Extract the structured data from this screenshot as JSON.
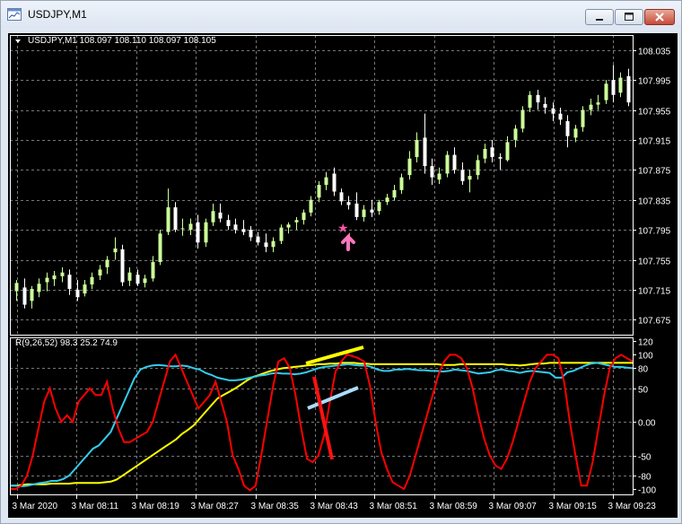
{
  "window": {
    "title": "USDJPY,M1"
  },
  "price_panel": {
    "info": "USDJPY,M1  108.097 108.110 108.097 108.105",
    "price_labels": [
      "108.035",
      "107.995",
      "107.955",
      "107.915",
      "107.875",
      "107.835",
      "107.795",
      "107.755",
      "107.715",
      "107.675"
    ]
  },
  "indicator_panel": {
    "info": "R(9,26,52) 98.3 25.2 74.9",
    "scale_labels": [
      "120",
      "100",
      "80",
      "50",
      "0.00",
      "-50",
      "-80",
      "-100"
    ]
  },
  "time_labels": [
    "3 Mar 2020",
    "3 Mar 08:11",
    "3 Mar 08:19",
    "3 Mar 08:27",
    "3 Mar 08:35",
    "3 Mar 08:43",
    "3 Mar 08:51",
    "3 Mar 08:59",
    "3 Mar 09:07",
    "3 Mar 09:15",
    "3 Mar 09:23"
  ],
  "colors": {
    "background": "#000000",
    "grid": "#777777",
    "bull_candle": "#ccff99",
    "bear_candle": "#ffffff",
    "fast_line": "#ff0000",
    "mid_line": "#33ccee",
    "slow_line": "#ffff00",
    "arrow": "#ff77bb"
  },
  "chart_data": {
    "type": "candlestick",
    "symbol": "USDJPY",
    "timeframe": "M1",
    "price_ylim": [
      107.655,
      108.055
    ],
    "candles": [
      [
        107.713,
        107.728,
        107.7,
        107.724
      ],
      [
        107.718,
        107.73,
        107.69,
        107.695
      ],
      [
        107.7,
        107.72,
        107.69,
        107.716
      ],
      [
        107.712,
        107.73,
        107.705,
        107.723
      ],
      [
        107.725,
        107.738,
        107.713,
        107.731
      ],
      [
        107.729,
        107.74,
        107.72,
        107.734
      ],
      [
        107.733,
        107.745,
        107.725,
        107.738
      ],
      [
        107.735,
        107.742,
        107.708,
        107.716
      ],
      [
        107.715,
        107.728,
        107.7,
        107.705
      ],
      [
        107.71,
        107.728,
        107.706,
        107.722
      ],
      [
        107.722,
        107.738,
        107.716,
        107.732
      ],
      [
        107.734,
        107.748,
        107.728,
        107.742
      ],
      [
        107.745,
        107.76,
        107.736,
        107.755
      ],
      [
        107.765,
        107.785,
        107.755,
        107.77
      ],
      [
        107.769,
        107.775,
        107.72,
        107.725
      ],
      [
        107.727,
        107.745,
        107.72,
        107.738
      ],
      [
        107.735,
        107.742,
        107.72,
        107.723
      ],
      [
        107.724,
        107.735,
        107.718,
        107.73
      ],
      [
        107.73,
        107.76,
        107.726,
        107.752
      ],
      [
        107.752,
        107.795,
        107.748,
        107.79
      ],
      [
        107.792,
        107.85,
        107.788,
        107.825
      ],
      [
        107.825,
        107.832,
        107.792,
        107.795
      ],
      [
        107.796,
        107.81,
        107.787,
        107.797
      ],
      [
        107.795,
        107.81,
        107.788,
        107.803
      ],
      [
        107.805,
        107.815,
        107.77,
        107.778
      ],
      [
        107.778,
        107.81,
        107.772,
        107.805
      ],
      [
        107.805,
        107.83,
        107.8,
        107.82
      ],
      [
        107.818,
        107.83,
        107.805,
        107.81
      ],
      [
        107.808,
        107.815,
        107.795,
        107.8
      ],
      [
        107.802,
        107.81,
        107.79,
        107.795
      ],
      [
        107.796,
        107.808,
        107.788,
        107.792
      ],
      [
        107.795,
        107.8,
        107.78,
        107.785
      ],
      [
        107.786,
        107.792,
        107.774,
        107.778
      ],
      [
        107.778,
        107.79,
        107.765,
        107.772
      ],
      [
        107.772,
        107.785,
        107.765,
        107.78
      ],
      [
        107.78,
        107.802,
        107.776,
        107.798
      ],
      [
        107.798,
        107.805,
        107.79,
        107.802
      ],
      [
        107.805,
        107.812,
        107.795,
        107.808
      ],
      [
        107.808,
        107.822,
        107.802,
        107.818
      ],
      [
        107.818,
        107.84,
        107.813,
        107.835
      ],
      [
        107.838,
        107.86,
        107.832,
        107.855
      ],
      [
        107.855,
        107.872,
        107.848,
        107.865
      ],
      [
        107.87,
        107.878,
        107.84,
        107.846
      ],
      [
        107.845,
        107.85,
        107.828,
        107.833
      ],
      [
        107.832,
        107.84,
        107.822,
        107.828
      ],
      [
        107.83,
        107.845,
        107.808,
        107.812
      ],
      [
        107.812,
        107.828,
        107.806,
        107.822
      ],
      [
        107.822,
        107.835,
        107.812,
        107.818
      ],
      [
        107.82,
        107.835,
        107.815,
        107.832
      ],
      [
        107.832,
        107.843,
        107.828,
        107.838
      ],
      [
        107.838,
        107.855,
        107.834,
        107.848
      ],
      [
        107.848,
        107.87,
        107.843,
        107.865
      ],
      [
        107.868,
        107.9,
        107.862,
        107.89
      ],
      [
        107.892,
        107.925,
        107.885,
        107.915
      ],
      [
        107.918,
        107.95,
        107.87,
        107.88
      ],
      [
        107.88,
        107.89,
        107.855,
        107.865
      ],
      [
        107.862,
        107.878,
        107.856,
        107.87
      ],
      [
        107.87,
        107.9,
        107.865,
        107.895
      ],
      [
        107.895,
        107.905,
        107.87,
        107.875
      ],
      [
        107.875,
        107.885,
        107.855,
        107.86
      ],
      [
        107.862,
        107.875,
        107.845,
        107.867
      ],
      [
        107.868,
        107.895,
        107.862,
        107.888
      ],
      [
        107.89,
        107.91,
        107.884,
        107.903
      ],
      [
        107.905,
        107.915,
        107.885,
        107.892
      ],
      [
        107.892,
        107.897,
        107.875,
        107.89
      ],
      [
        107.888,
        107.92,
        107.886,
        107.912
      ],
      [
        107.915,
        107.935,
        107.905,
        107.93
      ],
      [
        107.93,
        107.96,
        107.925,
        107.955
      ],
      [
        107.958,
        107.98,
        107.952,
        107.975
      ],
      [
        107.975,
        107.982,
        107.955,
        107.965
      ],
      [
        107.963,
        107.972,
        107.95,
        107.958
      ],
      [
        107.957,
        107.965,
        107.94,
        107.95
      ],
      [
        107.95,
        107.958,
        107.935,
        107.942
      ],
      [
        107.94,
        107.948,
        107.905,
        107.92
      ],
      [
        107.918,
        107.935,
        107.912,
        107.93
      ],
      [
        107.932,
        107.96,
        107.926,
        107.955
      ],
      [
        107.955,
        107.97,
        107.948,
        107.962
      ],
      [
        107.962,
        107.975,
        107.955,
        107.965
      ],
      [
        107.968,
        107.995,
        107.963,
        107.99
      ],
      [
        107.995,
        108.015,
        107.965,
        107.975
      ],
      [
        107.978,
        108.005,
        107.972,
        107.998
      ],
      [
        108.0,
        108.01,
        107.96,
        107.965
      ]
    ],
    "indicator": {
      "name": "R(9,26,52)",
      "ylim": [
        -108,
        126
      ],
      "last_values": [
        98.3,
        25.2,
        74.9
      ],
      "series": [
        {
          "name": "fast",
          "values": [
            -100,
            -100,
            -95,
            -80,
            -50,
            -10,
            30,
            50,
            20,
            0,
            10,
            0,
            30,
            40,
            50,
            40,
            40,
            60,
            20,
            -10,
            -30,
            -30,
            -25,
            -20,
            -15,
            0,
            30,
            60,
            90,
            100,
            80,
            60,
            40,
            20,
            30,
            40,
            60,
            30,
            0,
            -50,
            -70,
            -95,
            -102,
            -95,
            -50,
            0,
            50,
            90,
            95,
            80,
            40,
            -10,
            -55,
            -60,
            -50,
            -20,
            30,
            75,
            90,
            100,
            98,
            95,
            90,
            55,
            0,
            -45,
            -70,
            -90,
            -95,
            -100,
            -80,
            -50,
            -20,
            10,
            40,
            70,
            90,
            100,
            100,
            95,
            80,
            50,
            10,
            -25,
            -50,
            -65,
            -70,
            -55,
            -30,
            0,
            30,
            60,
            80,
            90,
            100,
            100,
            95,
            60,
            0,
            -50,
            -95,
            -95,
            -60,
            -10,
            40,
            80,
            95,
            100,
            95,
            90
          ]
        },
        {
          "name": "mid",
          "values": [
            -95,
            -95,
            -96,
            -95,
            -93,
            -91,
            -90,
            -88,
            -88,
            -85,
            -80,
            -70,
            -60,
            -50,
            -40,
            -35,
            -25,
            -15,
            5,
            25,
            45,
            65,
            78,
            82,
            84,
            85,
            84,
            83,
            83,
            84,
            83,
            80,
            78,
            73,
            70,
            66,
            64,
            62,
            62,
            63,
            65,
            67,
            69,
            70,
            72,
            73,
            72,
            72,
            71,
            72,
            74,
            77,
            80,
            82,
            83,
            84,
            85,
            86,
            85,
            84,
            84,
            82,
            78,
            76,
            76,
            78,
            78,
            79,
            78,
            77,
            77,
            76,
            76,
            75,
            76,
            78,
            77,
            76,
            74,
            72,
            73,
            74,
            77,
            78,
            76,
            75,
            73,
            75,
            76,
            75,
            74,
            73,
            66,
            66,
            74,
            76,
            80,
            84,
            87,
            88,
            86,
            84,
            82,
            82,
            81,
            80
          ]
        },
        {
          "name": "slow",
          "values": [
            -95,
            -95,
            -94,
            -93,
            -93,
            -93,
            -93,
            -92,
            -92,
            -92,
            -92,
            -91,
            -91,
            -91,
            -91,
            -91,
            -90,
            -89,
            -86,
            -80,
            -74,
            -68,
            -62,
            -56,
            -50,
            -44,
            -38,
            -32,
            -26,
            -18,
            -12,
            -5,
            5,
            15,
            25,
            35,
            40,
            45,
            50,
            56,
            62,
            67,
            70,
            73,
            76,
            78,
            80,
            81,
            82,
            83,
            84,
            85,
            86,
            86,
            87,
            87,
            88,
            88,
            88,
            87,
            87,
            86,
            86,
            86,
            86,
            86,
            86,
            86,
            86,
            86,
            86,
            86,
            86,
            85,
            85,
            85,
            86,
            86,
            86,
            86,
            86,
            86,
            86,
            86,
            85,
            85,
            84,
            85,
            86,
            87,
            87,
            88,
            88,
            88,
            88,
            88,
            88,
            88,
            88,
            88,
            88,
            88,
            88,
            88,
            88,
            88
          ]
        }
      ]
    }
  }
}
